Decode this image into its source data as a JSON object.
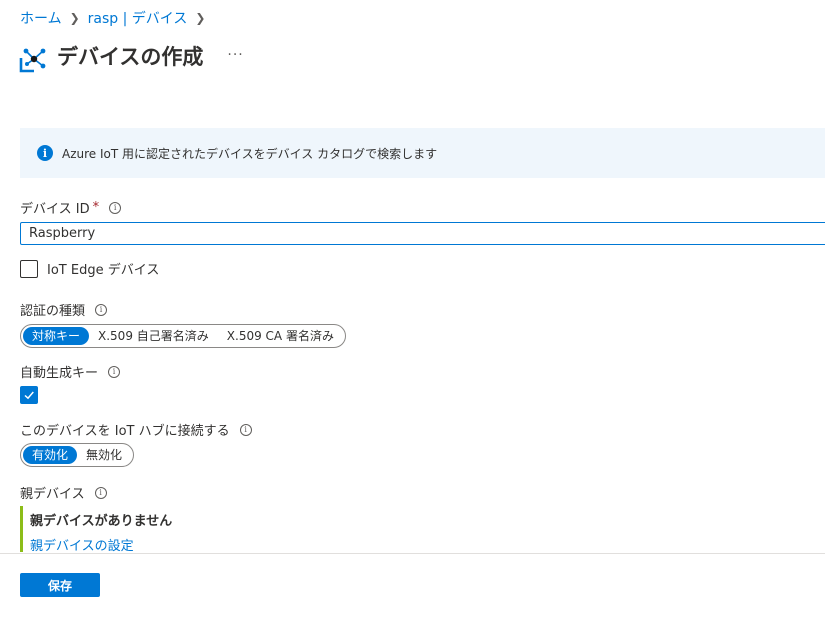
{
  "breadcrumb": {
    "items": [
      {
        "label": "ホーム"
      },
      {
        "label": "rasp | デバイス"
      }
    ]
  },
  "page": {
    "title": "デバイスの作成",
    "more_label": "···"
  },
  "info_bar": {
    "icon": "info-icon",
    "text": "Azure IoT 用に認定されたデバイスをデバイス カタログで検索します"
  },
  "device_id": {
    "label": "デバイス ID",
    "required_mark": "*",
    "value": "Raspberry"
  },
  "iot_edge": {
    "label": "IoT Edge デバイス",
    "checked": false
  },
  "auth_type": {
    "label": "認証の種類",
    "options": [
      "対称キー",
      "X.509 自己署名済み",
      "X.509 CA 署名済み"
    ],
    "selected": "対称キー"
  },
  "auto_generate": {
    "label": "自動生成キー",
    "checked": true
  },
  "connect_hub": {
    "label": "このデバイスを IoT ハブに接続する",
    "options": [
      "有効化",
      "無効化"
    ],
    "selected": "有効化"
  },
  "parent_device": {
    "label": "親デバイス",
    "none_text": "親デバイスがありません",
    "link": "親デバイスの設定"
  },
  "footer": {
    "save_label": "保存"
  },
  "colors": {
    "accent": "#0078d4",
    "info_background": "#eff6fc",
    "parent_border": "#8cbd18",
    "required": "#a4262c"
  }
}
